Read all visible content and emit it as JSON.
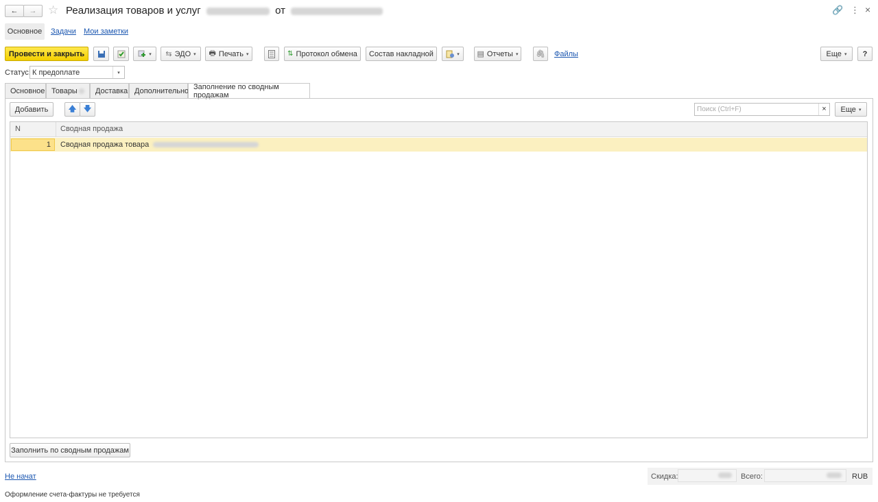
{
  "header": {
    "title": "Реализация товаров и услуг",
    "title_from": "от",
    "nav_back": "←",
    "nav_forward": "→"
  },
  "section_tabs": [
    {
      "label": "Основное"
    },
    {
      "label": "Задачи"
    },
    {
      "label": "Мои заметки"
    }
  ],
  "toolbar": {
    "post_close": "Провести и закрыть",
    "edo": "ЭДО",
    "print": "Печать",
    "exchange_protocol": "Протокол обмена",
    "invoice_content": "Состав накладной",
    "reports": "Отчеты",
    "files": "Файлы",
    "more": "Еще",
    "help": "?"
  },
  "status": {
    "label": "Статус:",
    "value": "К предоплате"
  },
  "tabs": [
    {
      "label": "Основное"
    },
    {
      "label": "Товары"
    },
    {
      "label": "Доставка"
    },
    {
      "label": "Дополнительно"
    },
    {
      "label": "Заполнение по сводным продажам"
    }
  ],
  "subtoolbar": {
    "add": "Добавить",
    "search_placeholder": "Поиск (Ctrl+F)",
    "more": "Еще",
    "clear": "×"
  },
  "table": {
    "columns": [
      "N",
      "Сводная продажа"
    ],
    "rows": [
      {
        "n": "1",
        "text": "Сводная продажа товара"
      }
    ]
  },
  "fill_button": "Заполнить по сводным продажам",
  "footer": {
    "edo_state": "Не начат",
    "discount_label": "Скидка:",
    "total_label": "Всего:",
    "currency": "RUB",
    "invoice_note": "Оформление счета-фактуры не требуется"
  },
  "colors": {
    "primary_button": "#f5d52a",
    "selected_row": "#fbf0c0",
    "link": "#1a56b0"
  }
}
